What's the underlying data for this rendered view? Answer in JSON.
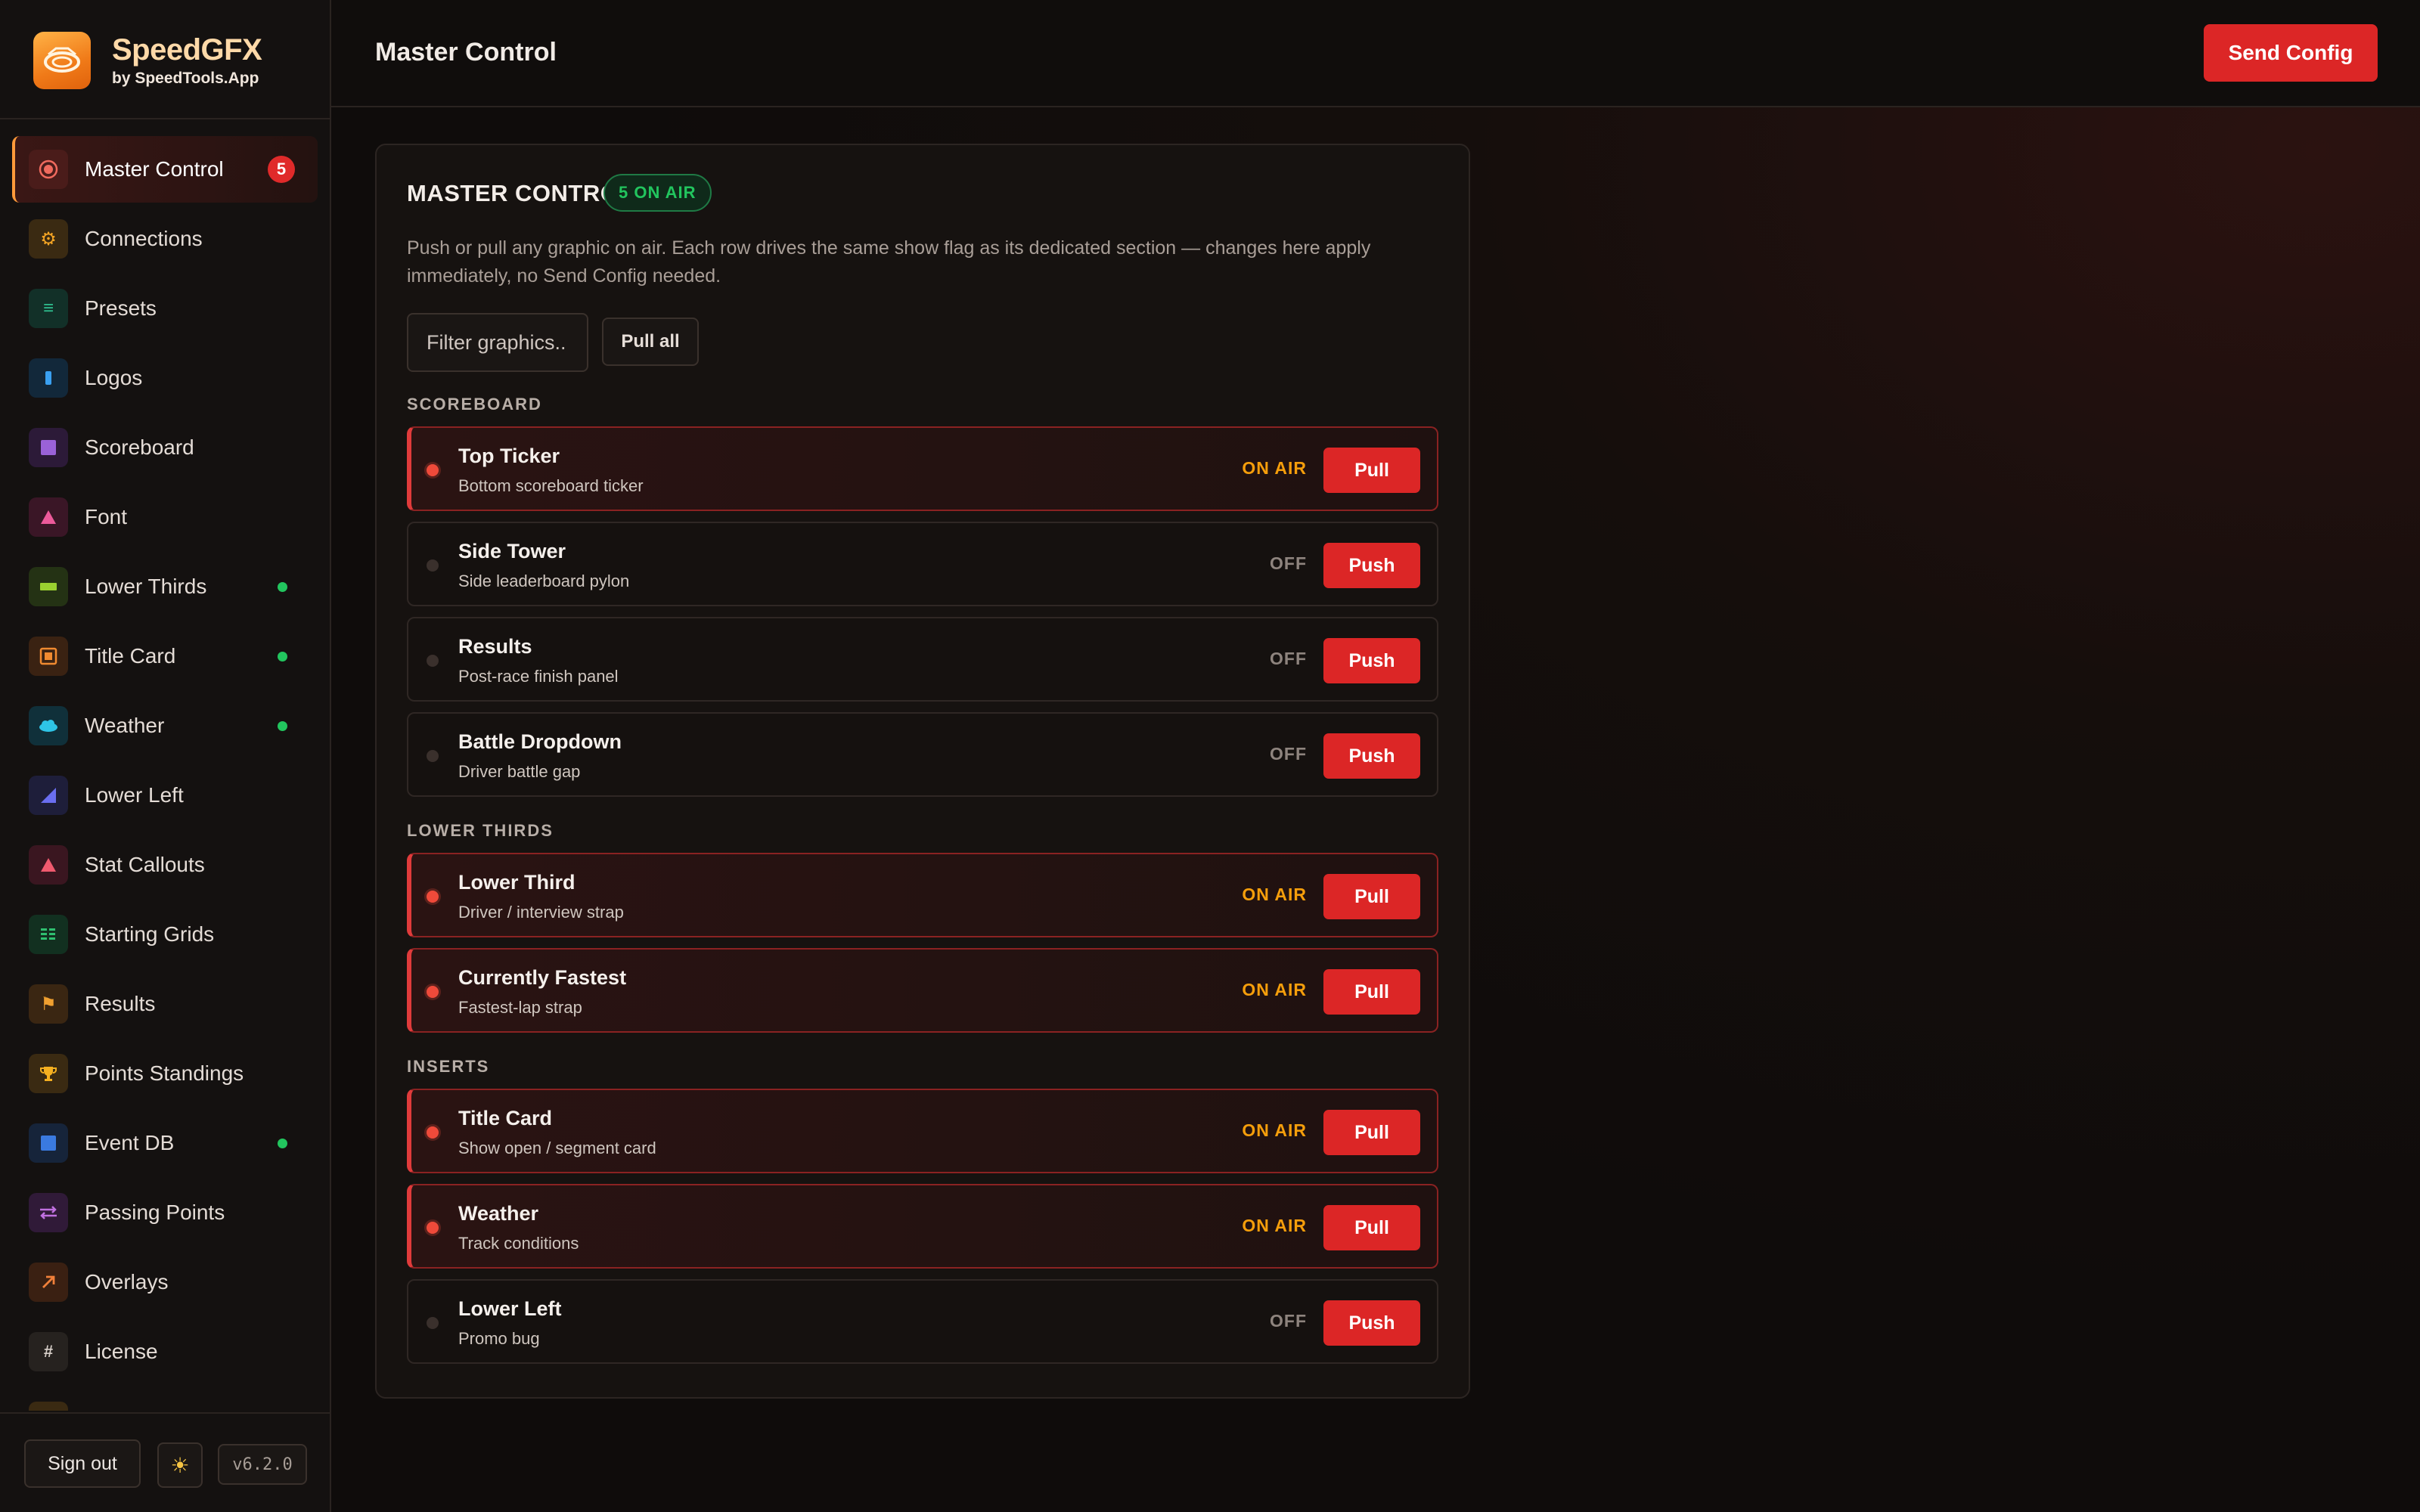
{
  "brand": {
    "name": "SpeedGFX",
    "sub": "by SpeedTools.App"
  },
  "sidebar": {
    "items": [
      {
        "label": "Master Control",
        "icon": "record-icon",
        "badge": "5"
      },
      {
        "label": "Connections",
        "icon": "gear-icon"
      },
      {
        "label": "Presets",
        "icon": "list-icon"
      },
      {
        "label": "Logos",
        "icon": "bar-icon"
      },
      {
        "label": "Scoreboard",
        "icon": "square-icon"
      },
      {
        "label": "Font",
        "icon": "triangle-icon"
      },
      {
        "label": "Lower Thirds",
        "icon": "strap-icon",
        "status": "active"
      },
      {
        "label": "Title Card",
        "icon": "card-icon",
        "status": "active"
      },
      {
        "label": "Weather",
        "icon": "cloud-icon",
        "status": "active"
      },
      {
        "label": "Lower Left",
        "icon": "corner-icon"
      },
      {
        "label": "Stat Callouts",
        "icon": "triangle-icon"
      },
      {
        "label": "Starting Grids",
        "icon": "grid-icon"
      },
      {
        "label": "Results",
        "icon": "flag-icon"
      },
      {
        "label": "Points Standings",
        "icon": "trophy-icon"
      },
      {
        "label": "Event DB",
        "icon": "database-icon",
        "status": "active"
      },
      {
        "label": "Passing Points",
        "icon": "swap-icon"
      },
      {
        "label": "Overlays",
        "icon": "arrow-icon"
      },
      {
        "label": "License",
        "icon": "hash-icon"
      }
    ],
    "signout_label": "Sign out",
    "theme_icon": "sun-icon",
    "version": "v6.2.0"
  },
  "header": {
    "title": "Master Control",
    "send_label": "Send Config"
  },
  "panel": {
    "title": "MASTER CONTROL",
    "onair_pill": "5 ON AIR",
    "description": "Push or pull any graphic on air. Each row drives the same show flag as its dedicated section — changes here apply immediately, no Send Config needed.",
    "filter_placeholder": "Filter graphics..",
    "pull_all_label": "Pull all",
    "sections": [
      {
        "label": "SCOREBOARD",
        "rows": [
          {
            "name": "Top Ticker",
            "sub": "Bottom scoreboard ticker",
            "status": "ON AIR",
            "action": "Pull"
          },
          {
            "name": "Side Tower",
            "sub": "Side leaderboard pylon",
            "status": "OFF",
            "action": "Push"
          },
          {
            "name": "Results",
            "sub": "Post-race finish panel",
            "status": "OFF",
            "action": "Push"
          },
          {
            "name": "Battle Dropdown",
            "sub": "Driver battle gap",
            "status": "OFF",
            "action": "Push"
          }
        ]
      },
      {
        "label": "LOWER THIRDS",
        "rows": [
          {
            "name": "Lower Third",
            "sub": "Driver / interview strap",
            "status": "ON AIR",
            "action": "Pull"
          },
          {
            "name": "Currently Fastest",
            "sub": "Fastest-lap strap",
            "status": "ON AIR",
            "action": "Pull"
          }
        ]
      },
      {
        "label": "INSERTS",
        "rows": [
          {
            "name": "Title Card",
            "sub": "Show open / segment card",
            "status": "ON AIR",
            "action": "Pull"
          },
          {
            "name": "Weather",
            "sub": "Track conditions",
            "status": "ON AIR",
            "action": "Pull"
          },
          {
            "name": "Lower Left",
            "sub": "Promo bug",
            "status": "OFF",
            "action": "Push"
          }
        ]
      }
    ]
  },
  "colors": {
    "accent": "#dc2626",
    "on_air": "#f59e0b",
    "live_dot": "#22c55e",
    "brand": "#f07a18"
  }
}
